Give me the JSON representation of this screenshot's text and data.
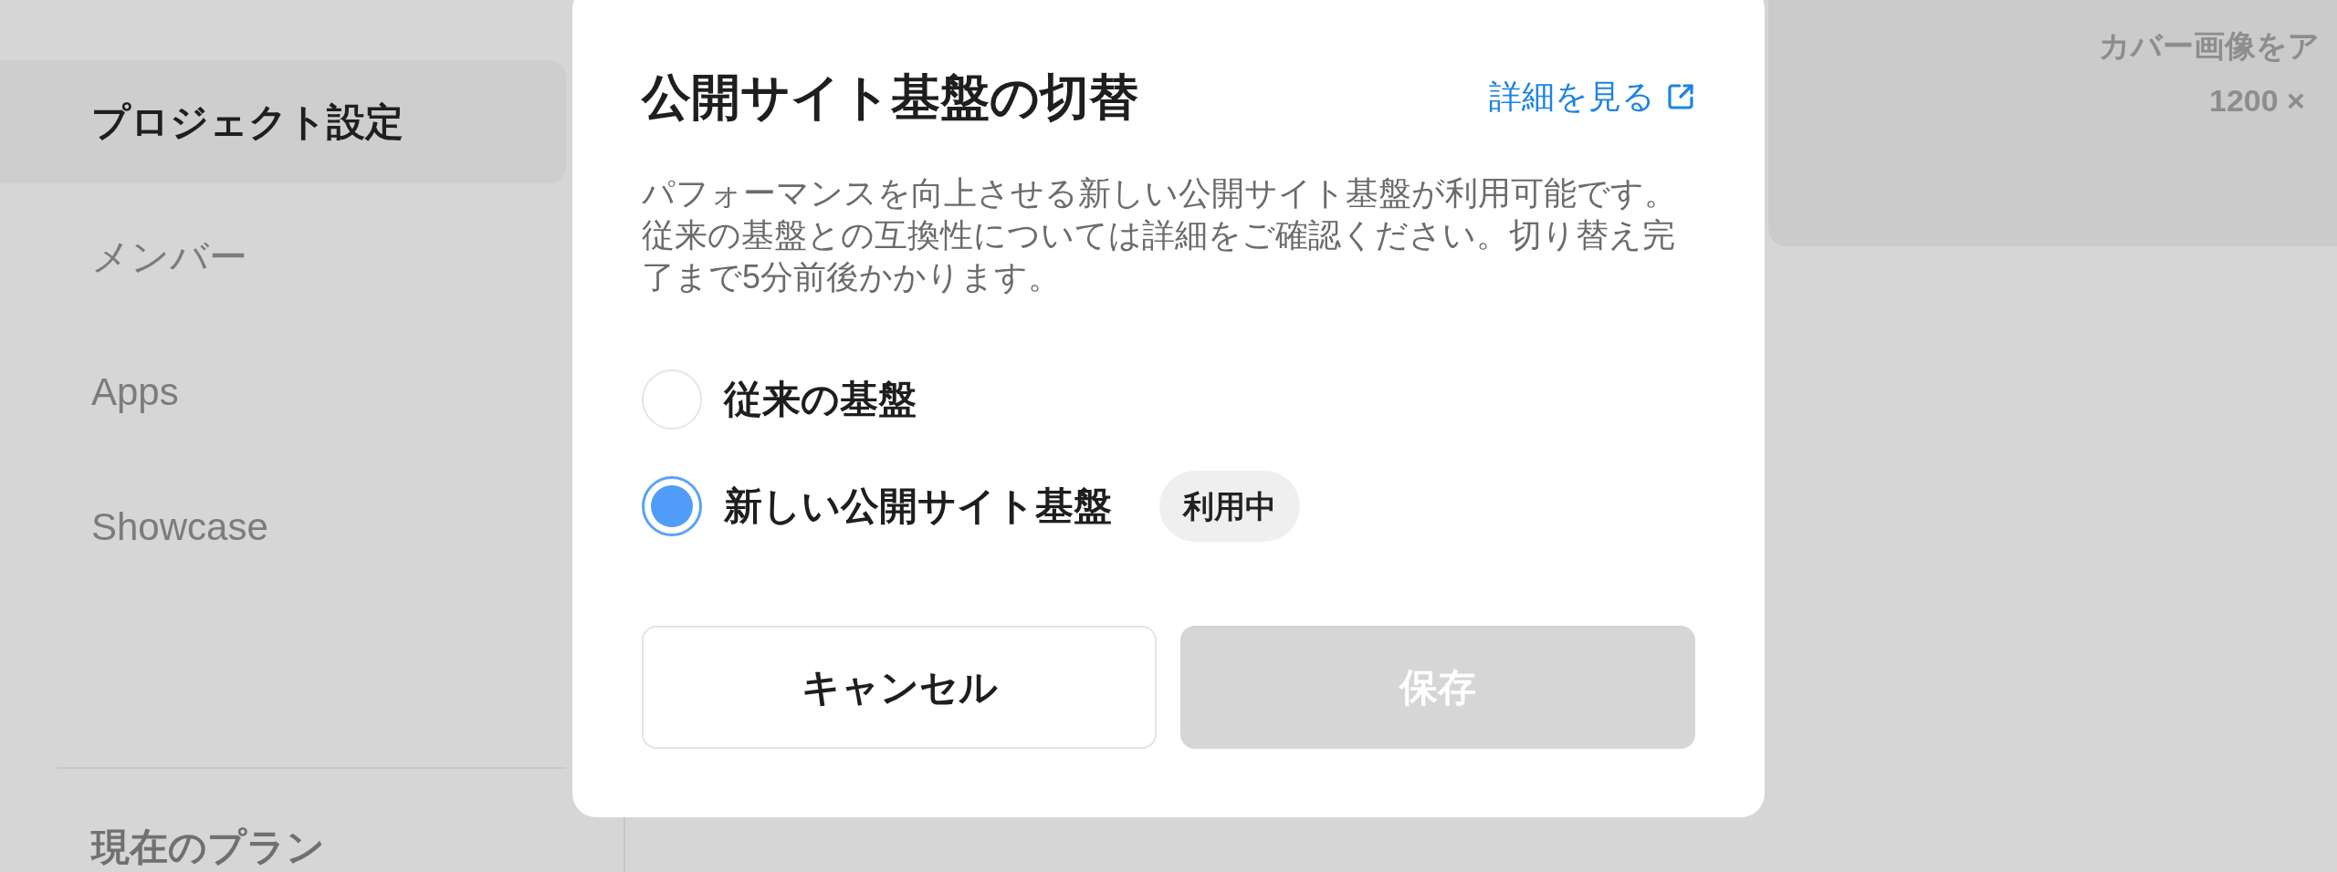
{
  "sidebar": {
    "items": [
      {
        "label": "プロジェクト設定",
        "selected": true
      },
      {
        "label": "メンバー",
        "selected": false
      },
      {
        "label": "Apps",
        "selected": false
      },
      {
        "label": "Showcase",
        "selected": false
      }
    ],
    "plan_heading": "現在のプラン"
  },
  "cover_upload": {
    "prompt": "カバー画像をア",
    "size": "1200 ×"
  },
  "dialog": {
    "title": "公開サイト基盤の切替",
    "details_link": "詳細を見る",
    "description": "パフォーマンスを向上させる新しい公開サイト基盤が利用可能です。従来の基盤との互換性については詳細をご確認ください。切り替え完了まで5分前後かかります。",
    "options": [
      {
        "label": "従来の基盤",
        "selected": false
      },
      {
        "label": "新しい公開サイト基盤",
        "selected": true,
        "badge": "利用中"
      }
    ],
    "buttons": [
      {
        "label": "キャンセル",
        "kind": "secondary",
        "disabled": false
      },
      {
        "label": "保存",
        "kind": "primary",
        "disabled": true
      }
    ]
  }
}
